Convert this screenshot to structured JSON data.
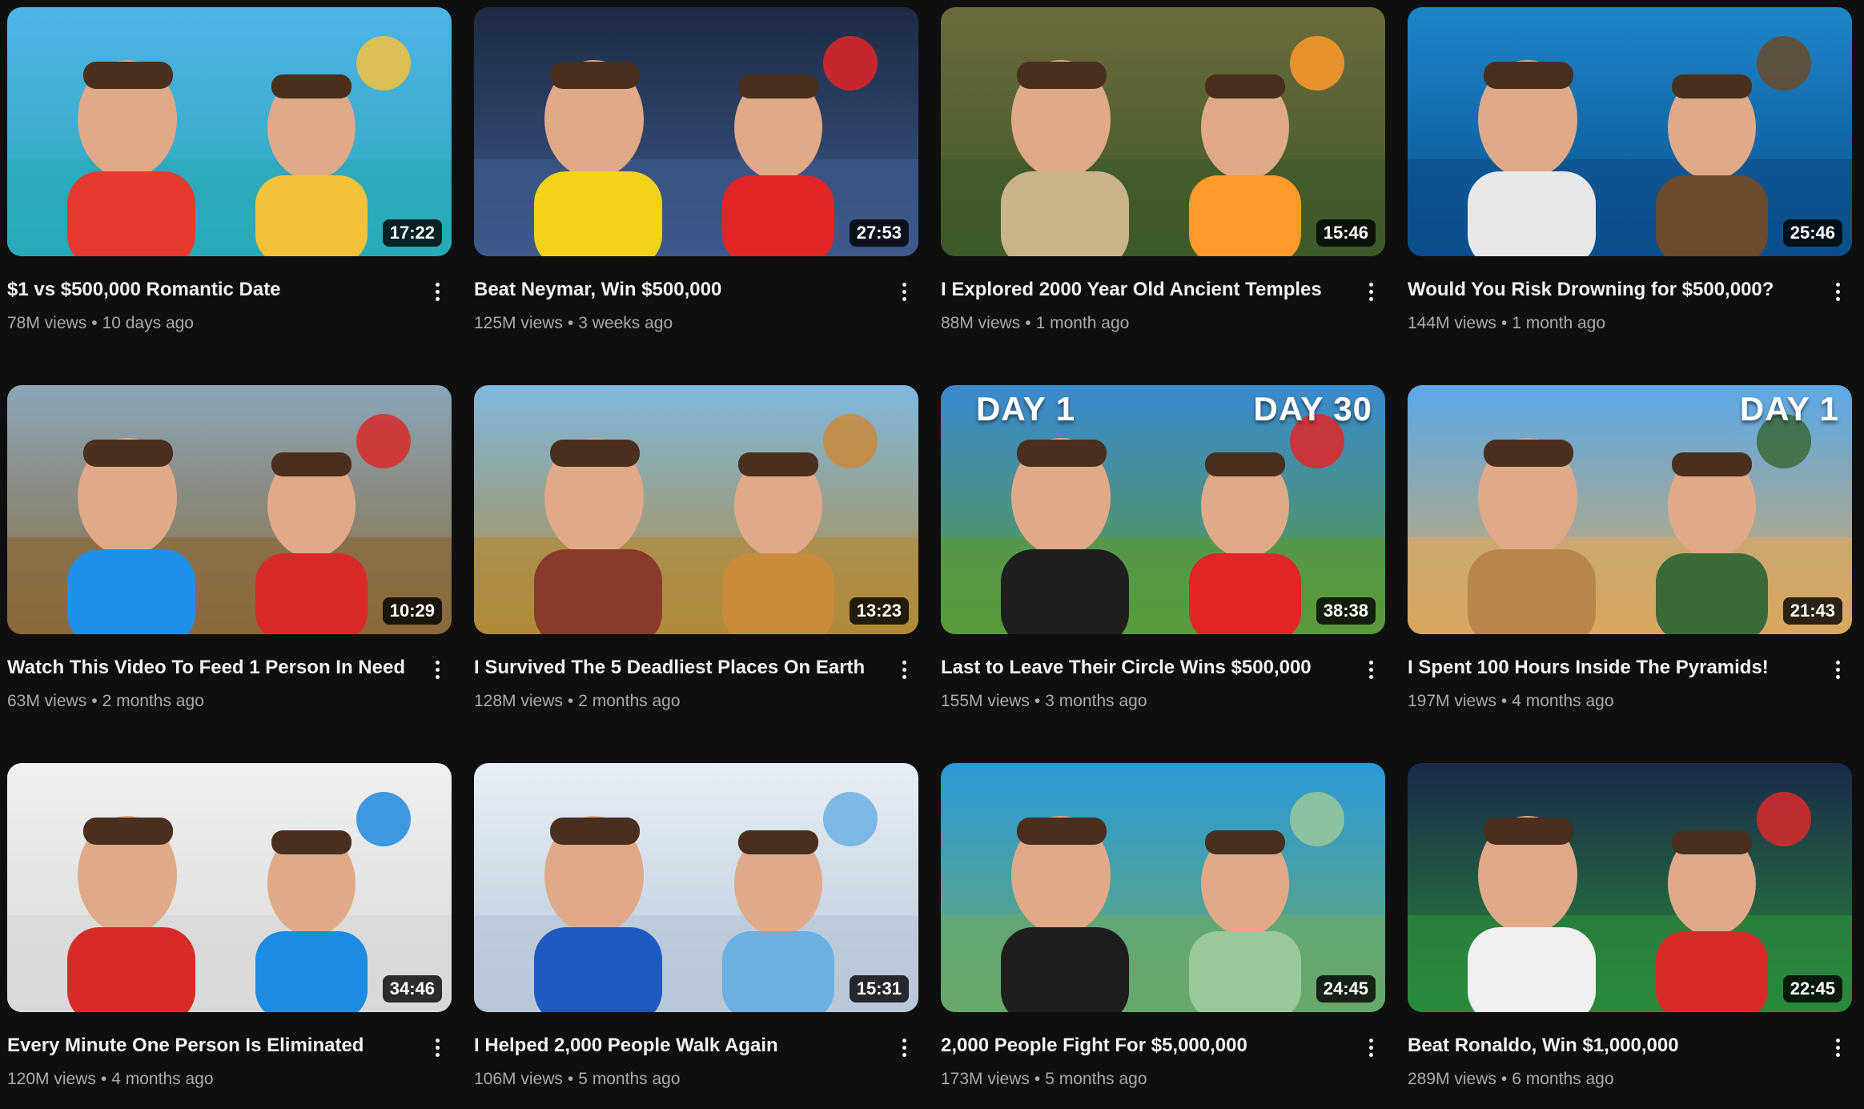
{
  "stat_separator": "•",
  "videos": [
    {
      "title": "$1 vs $500,000 Romantic Date",
      "views": "78M views",
      "age": "10 days ago",
      "duration": "17:22",
      "colors": {
        "bg1": "#4fb3e8",
        "bg2": "#2aa9b8",
        "fg": "#e63a2e",
        "accent": "#f5c23a"
      }
    },
    {
      "title": "Beat Neymar, Win $500,000",
      "views": "125M views",
      "age": "3 weeks ago",
      "duration": "27:53",
      "colors": {
        "bg1": "#1d2a45",
        "bg2": "#3d5a8a",
        "fg": "#f2d21b",
        "accent": "#e02626"
      }
    },
    {
      "title": "I Explored 2000 Year Old Ancient Temples",
      "views": "88M views",
      "age": "1 month ago",
      "duration": "15:46",
      "colors": {
        "bg1": "#6c6a3a",
        "bg2": "#3e5a2a",
        "fg": "#c9b48a",
        "accent": "#ff9a2a"
      }
    },
    {
      "title": "Would You Risk Drowning for $500,000?",
      "views": "144M views",
      "age": "1 month ago",
      "duration": "25:46",
      "colors": {
        "bg1": "#1c86c9",
        "bg2": "#0b4f8a",
        "fg": "#e8e8e8",
        "accent": "#6a4a2a"
      }
    },
    {
      "title": "Watch This Video To Feed 1 Person In Need",
      "views": "63M views",
      "age": "2 months ago",
      "duration": "10:29",
      "colors": {
        "bg1": "#8aa6b8",
        "bg2": "#8a6a3a",
        "fg": "#1e90e8",
        "accent": "#d92a2a"
      }
    },
    {
      "title": "I Survived The 5 Deadliest Places On Earth",
      "views": "128M views",
      "age": "2 months ago",
      "duration": "13:23",
      "colors": {
        "bg1": "#7fb8e0",
        "bg2": "#b08a3a",
        "fg": "#8a3a2a",
        "accent": "#c98a3a"
      }
    },
    {
      "title": "Last to Leave Their Circle Wins $500,000",
      "views": "155M views",
      "age": "3 months ago",
      "duration": "38:38",
      "overlay_left": "DAY 1",
      "overlay_right": "DAY 30",
      "colors": {
        "bg1": "#3a8ad0",
        "bg2": "#5a9a3a",
        "fg": "#1e1e1e",
        "accent": "#e02626"
      }
    },
    {
      "title": "I Spent 100 Hours Inside The Pyramids!",
      "views": "197M views",
      "age": "4 months ago",
      "duration": "21:43",
      "overlay_right": "DAY 1",
      "colors": {
        "bg1": "#5aa8e8",
        "bg2": "#d8a860",
        "fg": "#b8864a",
        "accent": "#3a6a3a"
      }
    },
    {
      "title": "Every Minute One Person Is Eliminated",
      "views": "120M views",
      "age": "4 months ago",
      "duration": "34:46",
      "colors": {
        "bg1": "#f0f0f0",
        "bg2": "#d8d8d8",
        "fg": "#d92a2a",
        "accent": "#1e8ae0"
      }
    },
    {
      "title": "I Helped 2,000 People Walk Again",
      "views": "106M views",
      "age": "5 months ago",
      "duration": "15:31",
      "colors": {
        "bg1": "#e8eef5",
        "bg2": "#b8c8d8",
        "fg": "#1e5ac0",
        "accent": "#6ab0e0"
      }
    },
    {
      "title": "2,000 People Fight For $5,000,000",
      "views": "173M views",
      "age": "5 months ago",
      "duration": "24:45",
      "colors": {
        "bg1": "#2a9ad8",
        "bg2": "#6aa86a",
        "fg": "#1e1e1e",
        "accent": "#9ac89a"
      }
    },
    {
      "title": "Beat Ronaldo, Win $1,000,000",
      "views": "289M views",
      "age": "6 months ago",
      "duration": "22:45",
      "colors": {
        "bg1": "#1a2a4a",
        "bg2": "#2a8a3a",
        "fg": "#f0f0f0",
        "accent": "#d92a2a"
      }
    }
  ]
}
